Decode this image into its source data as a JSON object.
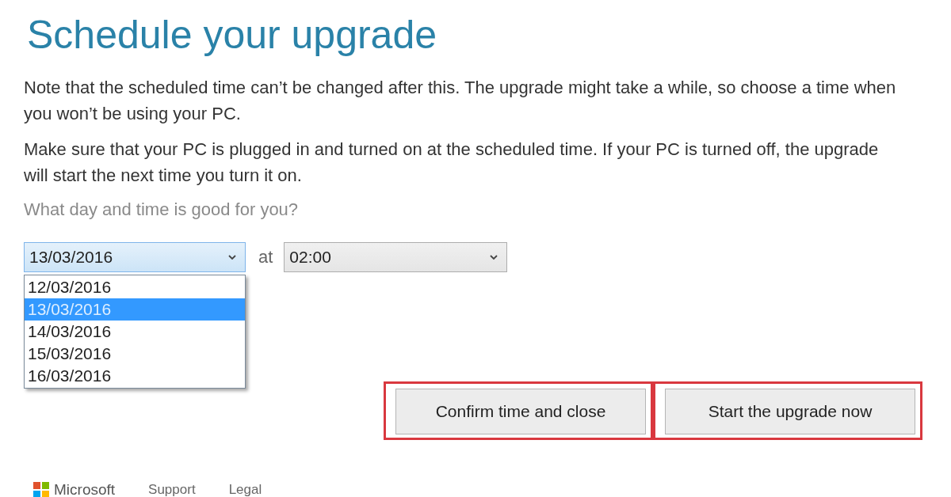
{
  "title": "Schedule your upgrade",
  "paragraphs": [
    "Note that the scheduled time can’t be changed after this. The upgrade might take a while, so choose a time when you won’t be using your PC.",
    "Make sure that your PC is plugged in and turned on at the scheduled time. If your PC is turned off, the upgrade will start the next time you turn it on."
  ],
  "question": "What day and time is good for you?",
  "date_select": {
    "value": "13/03/2016",
    "expanded": true,
    "options": [
      {
        "label": "12/03/2016",
        "selected": false
      },
      {
        "label": "13/03/2016",
        "selected": true
      },
      {
        "label": "14/03/2016",
        "selected": false
      },
      {
        "label": "15/03/2016",
        "selected": false
      },
      {
        "label": "16/03/2016",
        "selected": false
      }
    ]
  },
  "at_label": "at",
  "time_select": {
    "value": "02:00",
    "expanded": false
  },
  "buttons": [
    {
      "label": "Confirm time and close",
      "highlighted": true
    },
    {
      "label": "Start the upgrade now",
      "highlighted": true
    }
  ],
  "footer": {
    "logo_text": "Microsoft",
    "links": [
      "Support",
      "Legal"
    ]
  }
}
